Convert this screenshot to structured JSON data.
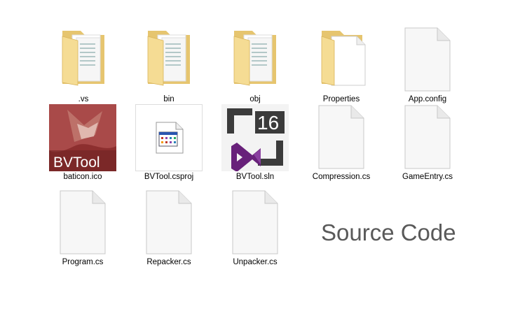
{
  "files": [
    {
      "label": ".vs",
      "type": "folder",
      "icon": "folder-icon"
    },
    {
      "label": "bin",
      "type": "folder",
      "icon": "folder-icon"
    },
    {
      "label": "obj",
      "type": "folder",
      "icon": "folder-icon"
    },
    {
      "label": "Properties",
      "type": "folder",
      "icon": "folder-open-icon"
    },
    {
      "label": "App.config",
      "type": "file",
      "icon": "document-icon"
    },
    {
      "label": "baticon.ico",
      "type": "image",
      "icon": "bvtool-image-icon",
      "thumb_text": "BVTool"
    },
    {
      "label": "BVTool.csproj",
      "type": "project",
      "icon": "csproj-icon"
    },
    {
      "label": "BVTool.sln",
      "type": "solution",
      "icon": "visual-studio-icon",
      "badge": "16"
    },
    {
      "label": "Compression.cs",
      "type": "file",
      "icon": "document-icon"
    },
    {
      "label": "GameEntry.cs",
      "type": "file",
      "icon": "document-icon"
    },
    {
      "label": "Program.cs",
      "type": "file",
      "icon": "document-icon"
    },
    {
      "label": "Repacker.cs",
      "type": "file",
      "icon": "document-icon"
    },
    {
      "label": "Unpacker.cs",
      "type": "file",
      "icon": "document-icon"
    }
  ],
  "caption": "Source Code",
  "colors": {
    "folder": "#f2d88c",
    "vs_purple": "#68217a",
    "caption": "#595959"
  }
}
